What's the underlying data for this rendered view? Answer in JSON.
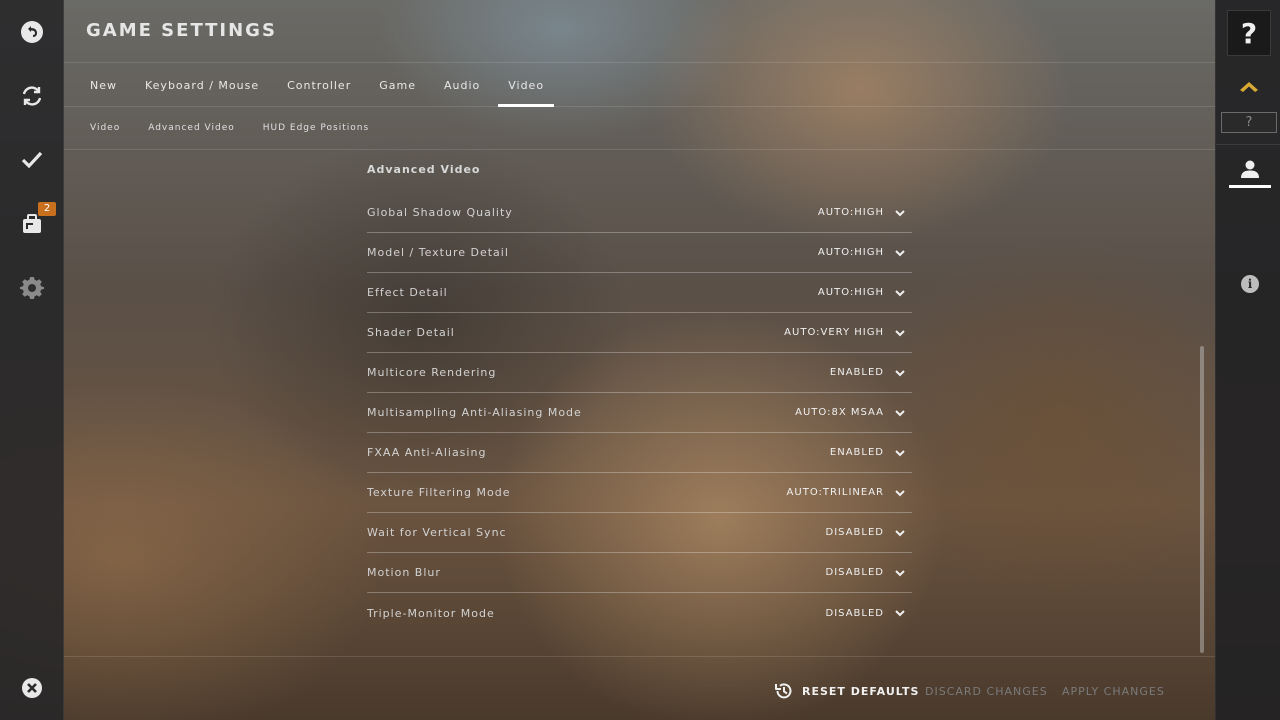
{
  "header": {
    "title": "GAME SETTINGS"
  },
  "tabs": [
    {
      "label": "New",
      "active": false
    },
    {
      "label": "Keyboard / Mouse",
      "active": false
    },
    {
      "label": "Controller",
      "active": false
    },
    {
      "label": "Game",
      "active": false
    },
    {
      "label": "Audio",
      "active": false
    },
    {
      "label": "Video",
      "active": true
    }
  ],
  "subtabs": [
    {
      "label": "Video"
    },
    {
      "label": "Advanced Video"
    },
    {
      "label": "HUD Edge Positions"
    }
  ],
  "section": {
    "title": "Advanced Video"
  },
  "settings": [
    {
      "label": "Global Shadow Quality",
      "value": "AUTO:HIGH"
    },
    {
      "label": "Model / Texture Detail",
      "value": "AUTO:HIGH"
    },
    {
      "label": "Effect Detail",
      "value": "AUTO:HIGH"
    },
    {
      "label": "Shader Detail",
      "value": "AUTO:VERY HIGH"
    },
    {
      "label": "Multicore Rendering",
      "value": "ENABLED"
    },
    {
      "label": "Multisampling Anti-Aliasing Mode",
      "value": "AUTO:8X MSAA"
    },
    {
      "label": "FXAA Anti-Aliasing",
      "value": "ENABLED"
    },
    {
      "label": "Texture Filtering Mode",
      "value": "AUTO:TRILINEAR"
    },
    {
      "label": "Wait for Vertical Sync",
      "value": "DISABLED"
    },
    {
      "label": "Motion Blur",
      "value": "DISABLED"
    },
    {
      "label": "Triple-Monitor Mode",
      "value": "DISABLED"
    }
  ],
  "footer": {
    "reset_label": "RESET DEFAULTS",
    "discard_label": "DISCARD CHANGES",
    "apply_label": "APPLY CHANGES"
  },
  "left_rail": {
    "inventory_badge": "2",
    "icons": [
      "back-arrow-icon",
      "refresh-icon",
      "check-icon",
      "inventory-icon",
      "gear-icon",
      "close-icon"
    ]
  },
  "right_rail": {
    "help_label": "?",
    "rank_label": "?",
    "info_label": "i"
  },
  "colors": {
    "badge": "#c8701e",
    "rank_chevron": "#d9a934",
    "active_tab_underline": "#ffffff"
  }
}
